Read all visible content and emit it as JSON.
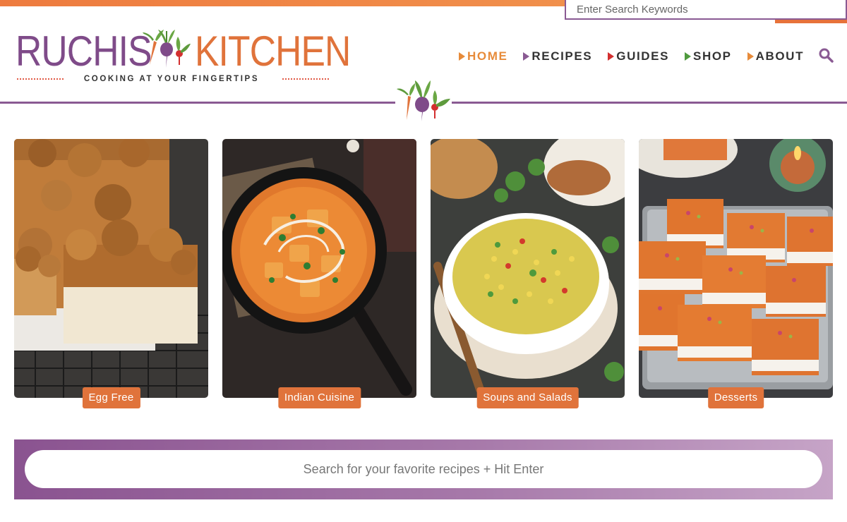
{
  "header": {
    "top_search_placeholder": "Enter Search Keywords",
    "logo": {
      "word_left": "RUCHIS",
      "word_right": "KITCHEN",
      "tagline": "COOKING AT YOUR FINGERTIPS"
    },
    "nav": [
      {
        "label": "HOME",
        "arrow_color": "#e78b3a",
        "active": true
      },
      {
        "label": "RECIPES",
        "arrow_color": "#8a5a93",
        "active": false
      },
      {
        "label": "GUIDES",
        "arrow_color": "#d32f2f",
        "active": false
      },
      {
        "label": "SHOP",
        "arrow_color": "#4f9a3e",
        "active": false
      },
      {
        "label": "ABOUT",
        "arrow_color": "#e78b3a",
        "active": false
      }
    ],
    "search_icon": "search-icon"
  },
  "categories": [
    {
      "label": "Egg Free",
      "image": "coffee-cake-photo"
    },
    {
      "label": "Indian Cuisine",
      "image": "paneer-curry-photo"
    },
    {
      "label": "Soups and Salads",
      "image": "corn-soup-photo"
    },
    {
      "label": "Desserts",
      "image": "carrot-halwa-squares-photo"
    }
  ],
  "recipe_search": {
    "placeholder": "Search for your favorite recipes + Hit Enter"
  },
  "colors": {
    "brand_purple": "#7f4b89",
    "brand_orange": "#e0733b",
    "top_bar": "#ee7b3f"
  }
}
